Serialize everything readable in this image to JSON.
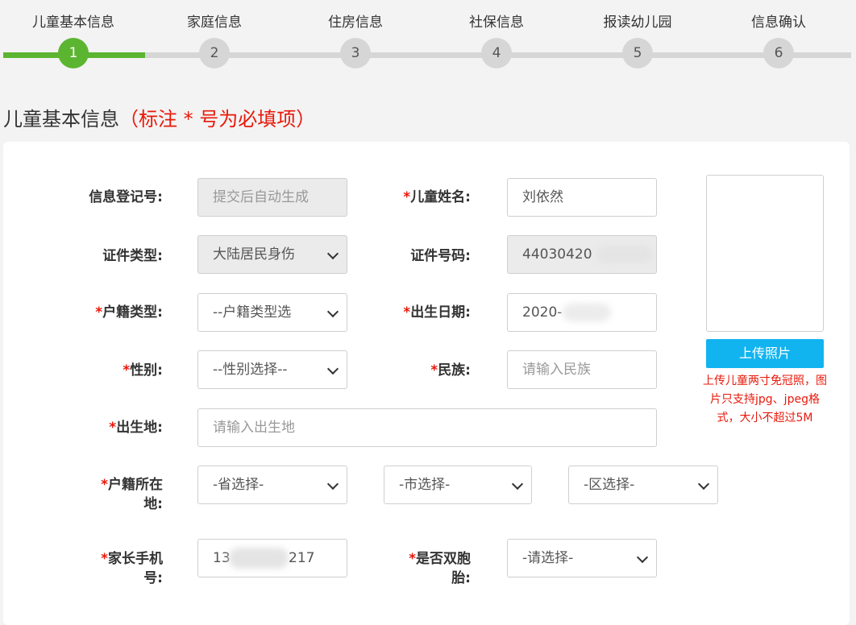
{
  "stepper": {
    "steps": [
      {
        "label": "儿童基本信息",
        "number": "1"
      },
      {
        "label": "家庭信息",
        "number": "2"
      },
      {
        "label": "住房信息",
        "number": "3"
      },
      {
        "label": "社保信息",
        "number": "4"
      },
      {
        "label": "报读幼儿园",
        "number": "5"
      },
      {
        "label": "信息确认",
        "number": "6"
      }
    ],
    "current_step": 1,
    "colors": {
      "active": "#5cb531",
      "inactive": "#d6d6d6"
    }
  },
  "section": {
    "title": "儿童基本信息",
    "note": "（标注 * 号为必填项）"
  },
  "form": {
    "required_mark": "*",
    "reg_no": {
      "label": "信息登记号:",
      "value": "提交后自动生成"
    },
    "child_name": {
      "label": "儿童姓名:",
      "value": "刘依然"
    },
    "id_type": {
      "label": "证件类型:",
      "value": "大陆居民身伤"
    },
    "id_number": {
      "label": "证件号码:",
      "value": "44030420"
    },
    "hukou_type": {
      "label": "户籍类型:",
      "value": "--户籍类型选"
    },
    "birth_date": {
      "label": "出生日期:",
      "value": "2020-"
    },
    "gender": {
      "label": "性别:",
      "value": "--性别选择--"
    },
    "ethnicity": {
      "label": "民族:",
      "placeholder": "请输入民族"
    },
    "birthplace": {
      "label": "出生地:",
      "placeholder": "请输入出生地"
    },
    "hukou_location": {
      "label_line1": "户籍所在",
      "label_line2": "地:",
      "province": "-省选择-",
      "city": "-市选择-",
      "district": "-区选择-"
    },
    "parent_phone": {
      "label_line1": "家长手机",
      "label_line2": "号:",
      "value_start": "13",
      "value_end": "217"
    },
    "twins": {
      "label_line1": "是否双胞",
      "label_line2": "胎:",
      "value": "-请选择-"
    }
  },
  "photo": {
    "upload_label": "上传照片",
    "tip": "上传儿童两寸免冠照，图片只支持jpg、jpeg格式，大小不超过5M"
  },
  "colors": {
    "required": "#e8190b",
    "upload_button": "#12b4f0"
  }
}
